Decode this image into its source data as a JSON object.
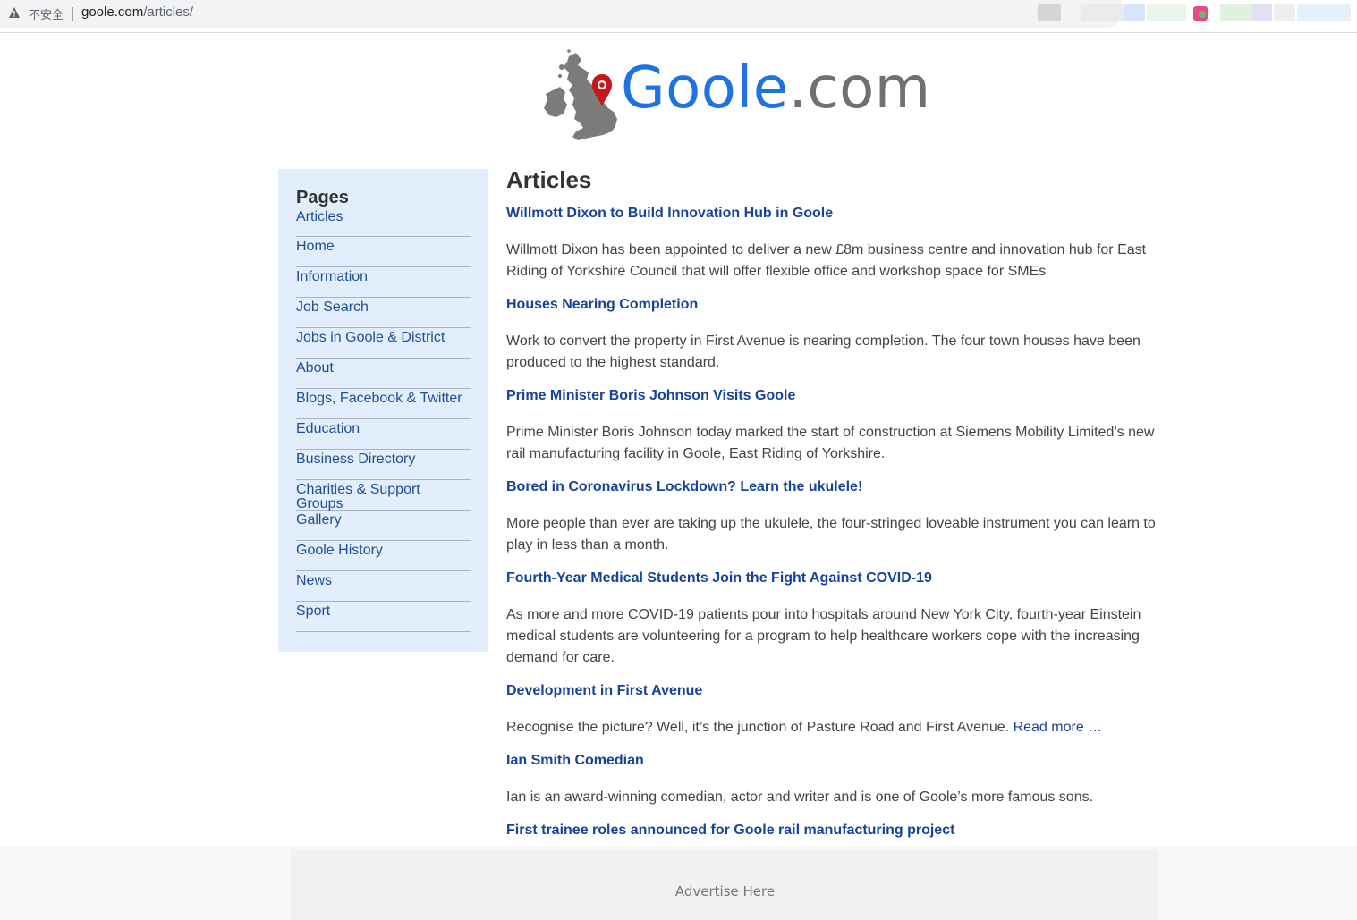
{
  "browser": {
    "security_label": "不安全",
    "url_host": "goole.com",
    "url_path": "/articles/"
  },
  "logo": {
    "main": "Goole",
    "tld": ".com",
    "brand_color": "#1e73e0",
    "map_icon": "uk-map-pin-icon"
  },
  "sidebar": {
    "title": "Pages",
    "items": [
      {
        "label": "Articles"
      },
      {
        "label": "Home"
      },
      {
        "label": "Information"
      },
      {
        "label": "Job Search"
      },
      {
        "label": "Jobs in Goole & District"
      },
      {
        "label": "About"
      },
      {
        "label": "Blogs, Facebook & Twitter"
      },
      {
        "label": "Education"
      },
      {
        "label": "Business Directory"
      },
      {
        "label": "Charities & Support Groups"
      },
      {
        "label": "Gallery"
      },
      {
        "label": "Goole History"
      },
      {
        "label": "News"
      },
      {
        "label": "Sport"
      }
    ]
  },
  "main": {
    "title": "Articles",
    "articles": [
      {
        "title": "Willmott Dixon to Build Innovation Hub in Goole",
        "summary": "Willmott Dixon has been appointed to deliver a new £8m business centre and innovation hub for East Riding of Yorkshire Council that will offer flexible office and workshop space for SMEs"
      },
      {
        "title": "Houses Nearing Completion",
        "summary": "Work to convert the property in First Avenue is nearing completion. The four town houses have been produced to the highest standard."
      },
      {
        "title": "Prime Minister Boris Johnson Visits Goole",
        "summary": "Prime Minister Boris Johnson today marked the start of construction at Siemens Mobility Limited’s new rail manufacturing facility in Goole, East Riding of Yorkshire."
      },
      {
        "title": "Bored in Coronavirus Lockdown? Learn the ukulele!",
        "summary": "More people than ever are taking up the ukulele, the four-stringed loveable instrument you can learn to play in less than a month."
      },
      {
        "title": "Fourth-Year Medical Students Join the Fight Against COVID-19",
        "summary": "As more and more COVID-19 patients pour into hospitals around New York City, fourth-year Einstein medical students are volunteering for a program to help healthcare workers cope with the increasing demand for care."
      },
      {
        "title": "Development in First Avenue",
        "summary": "Recognise the picture? Well, it’s the junction of Pasture Road and First Avenue.",
        "read_more": "Read more …"
      },
      {
        "title": "Ian Smith Comedian",
        "summary": "Ian is an award-winning comedian, actor and writer and is one of Goole’s more famous sons."
      },
      {
        "title": "First trainee roles announced for Goole rail manufacturing project"
      }
    ]
  },
  "ad": {
    "label": "Advertise Here"
  }
}
